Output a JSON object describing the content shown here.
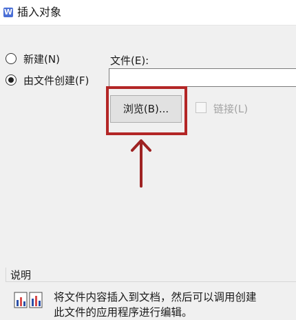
{
  "dialog": {
    "app_icon": "W",
    "title": "插入对象"
  },
  "options": {
    "new_label": "新建(N)",
    "from_file_label": "由文件创建(F)",
    "selected": "from_file"
  },
  "file": {
    "label": "文件(E):",
    "value": ""
  },
  "browse": {
    "label": "浏览(B)..."
  },
  "link": {
    "label": "链接(L)",
    "checked": false,
    "enabled": false
  },
  "description": {
    "group_label": "说明",
    "text_line1": "将文件内容插入到文档，然后可以调用创建",
    "text_line2": "此文件的应用程序进行编辑。"
  },
  "colors": {
    "highlight": "#b32626",
    "arrow": "#9e2222"
  },
  "icons": [
    "wps-app-icon",
    "document-object-icon",
    "arrow-up-icon"
  ]
}
